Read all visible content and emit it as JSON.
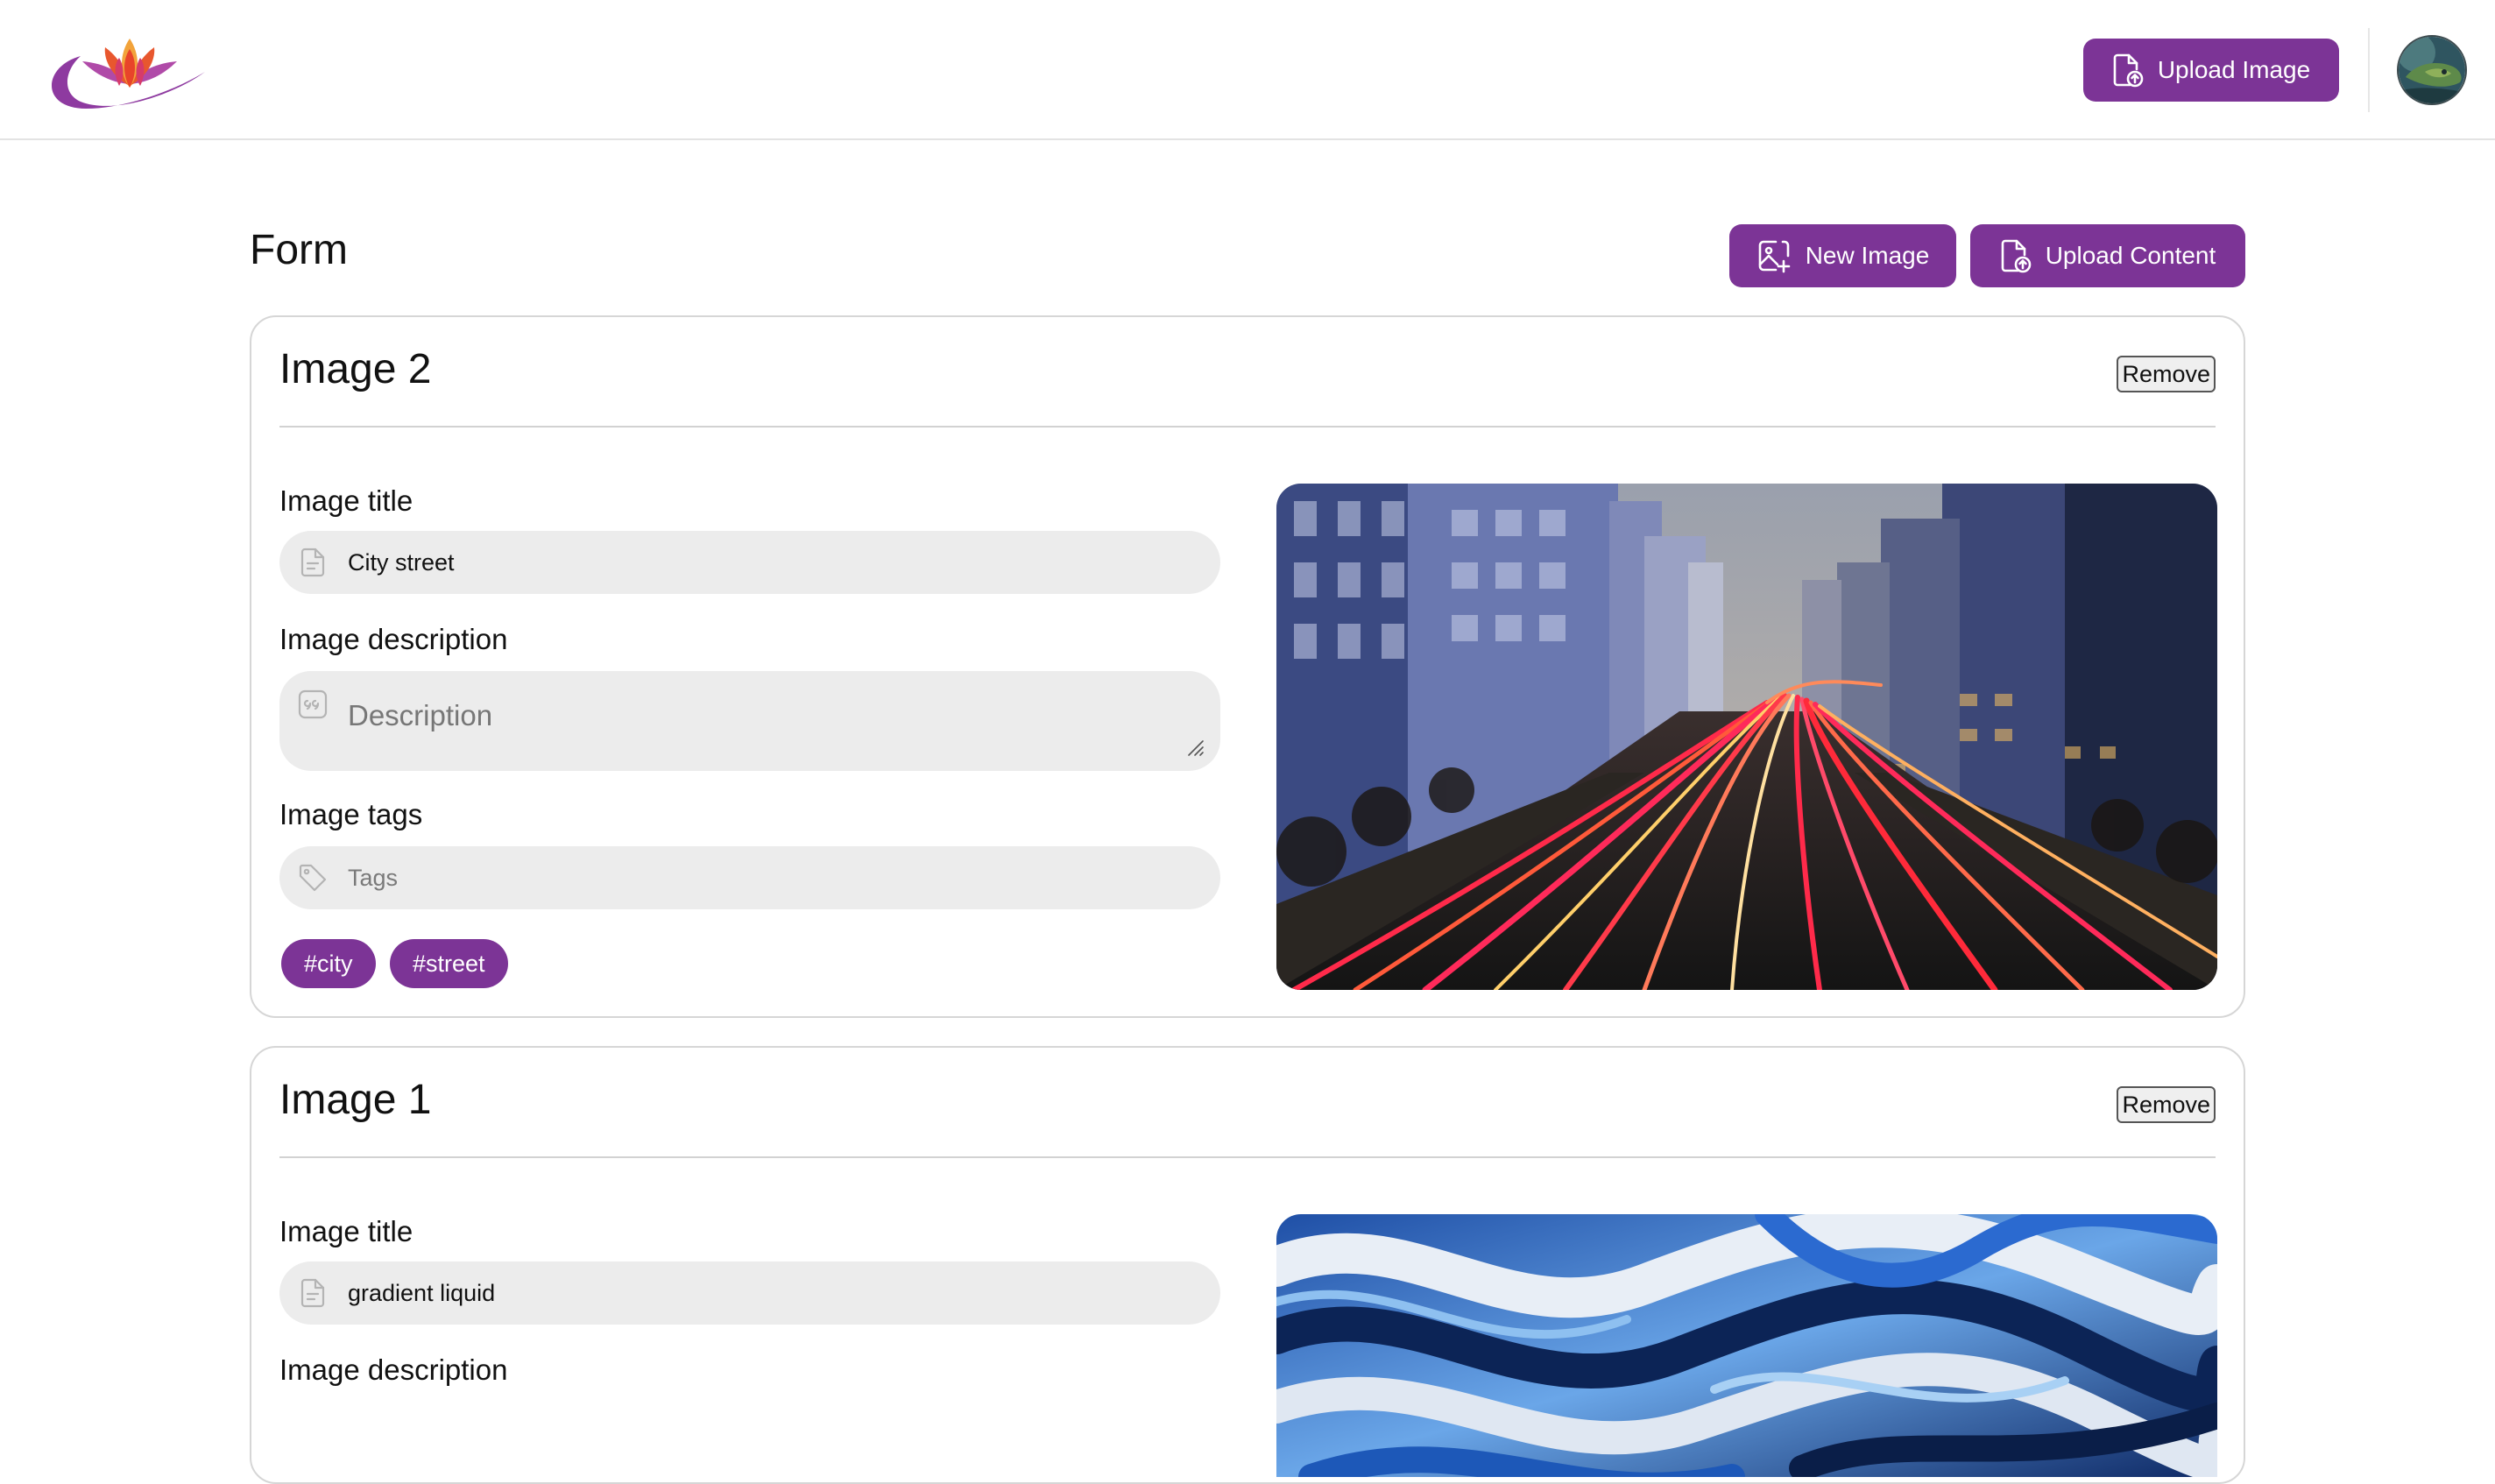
{
  "header": {
    "upload_image_label": "Upload Image"
  },
  "page": {
    "title": "Form",
    "new_image_label": "New Image",
    "upload_content_label": "Upload Content"
  },
  "cards": [
    {
      "title": "Image 2",
      "remove_label": "Remove",
      "title_label": "Image title",
      "title_value": "City street",
      "description_label": "Image description",
      "description_placeholder": "Description",
      "tags_label": "Image tags",
      "tags_placeholder": "Tags",
      "tags": [
        "#city",
        "#street"
      ]
    },
    {
      "title": "Image 1",
      "remove_label": "Remove",
      "title_label": "Image title",
      "title_value": "gradient liquid",
      "description_label": "Image description"
    }
  ],
  "icons": {
    "logo": "lotus-logo",
    "upload": "file-upload-icon",
    "new_image": "image-plus-icon",
    "title_field": "document-icon",
    "description_field": "quote-icon",
    "tags_field": "tag-icon"
  },
  "colors": {
    "accent": "#7c3496",
    "field_bg": "#ececec",
    "card_border": "#d6d6d6"
  }
}
